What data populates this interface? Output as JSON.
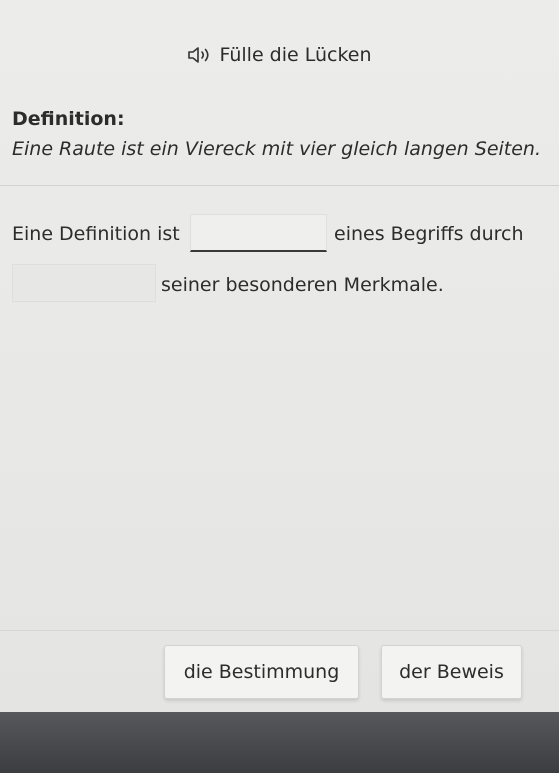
{
  "header": {
    "title": "Fülle die Lücken",
    "icon": "speaker-icon"
  },
  "definition": {
    "label": "Definition:",
    "text": "Eine Raute ist ein Viereck mit vier gleich langen Seiten."
  },
  "sentence": {
    "part1": "Eine Definition ist",
    "part2": "eines Begriffs durch",
    "part3": "seiner besonderen Merkmale."
  },
  "options": [
    {
      "label": "die Bestimmung"
    },
    {
      "label": "der Beweis"
    }
  ]
}
